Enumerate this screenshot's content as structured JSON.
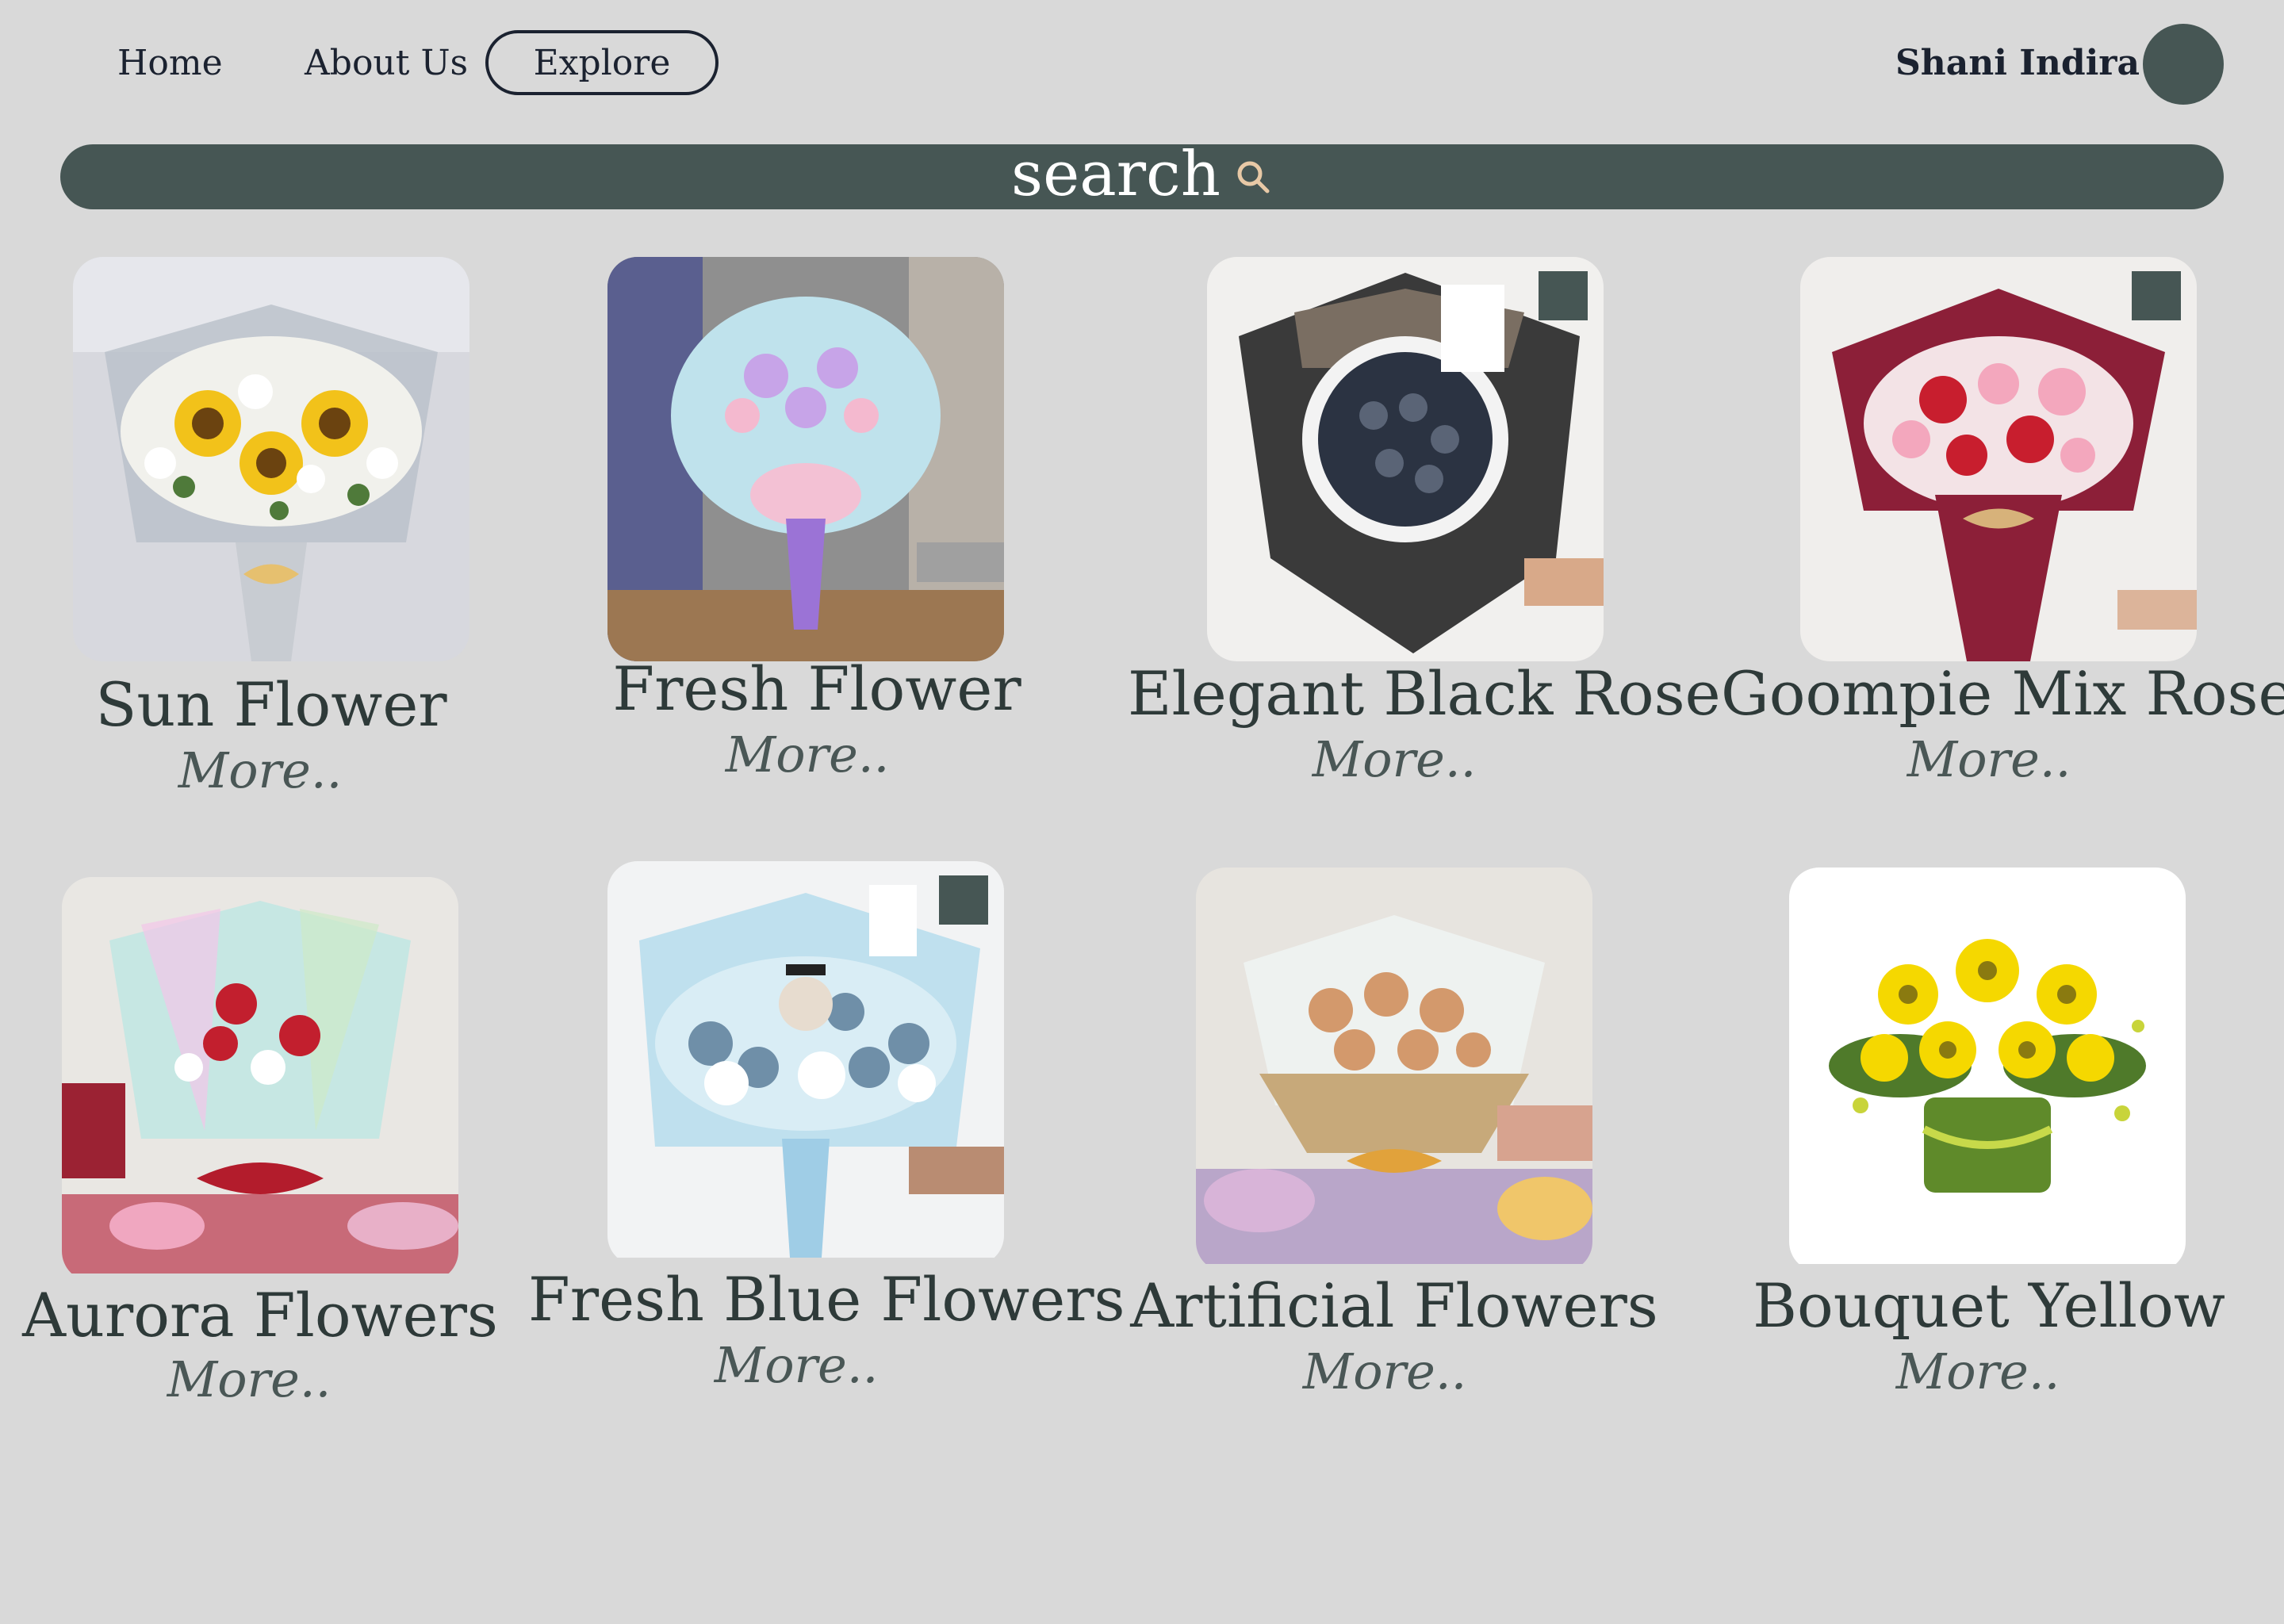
{
  "nav": {
    "home": "Home",
    "about": "About Us",
    "explore": "Explore"
  },
  "user": {
    "name": "Shani Indira"
  },
  "search": {
    "label": "search"
  },
  "products": [
    {
      "title": "Sun Flower",
      "more": "More.."
    },
    {
      "title": "Fresh Flower",
      "more": "More.."
    },
    {
      "title": "Elegant Black Rose",
      "more": "More.."
    },
    {
      "title": "Goompie Mix Roses",
      "more": "More.."
    },
    {
      "title": "Aurora Flowers",
      "more": "More.."
    },
    {
      "title": "Fresh Blue Flowers",
      "more": "More.."
    },
    {
      "title": "Artificial Flowers",
      "more": "More.."
    },
    {
      "title": "Bouquet Yellow",
      "more": "More.."
    }
  ],
  "colors": {
    "background": "#d9d9d9",
    "accent": "#465654",
    "text": "#1b2230"
  }
}
